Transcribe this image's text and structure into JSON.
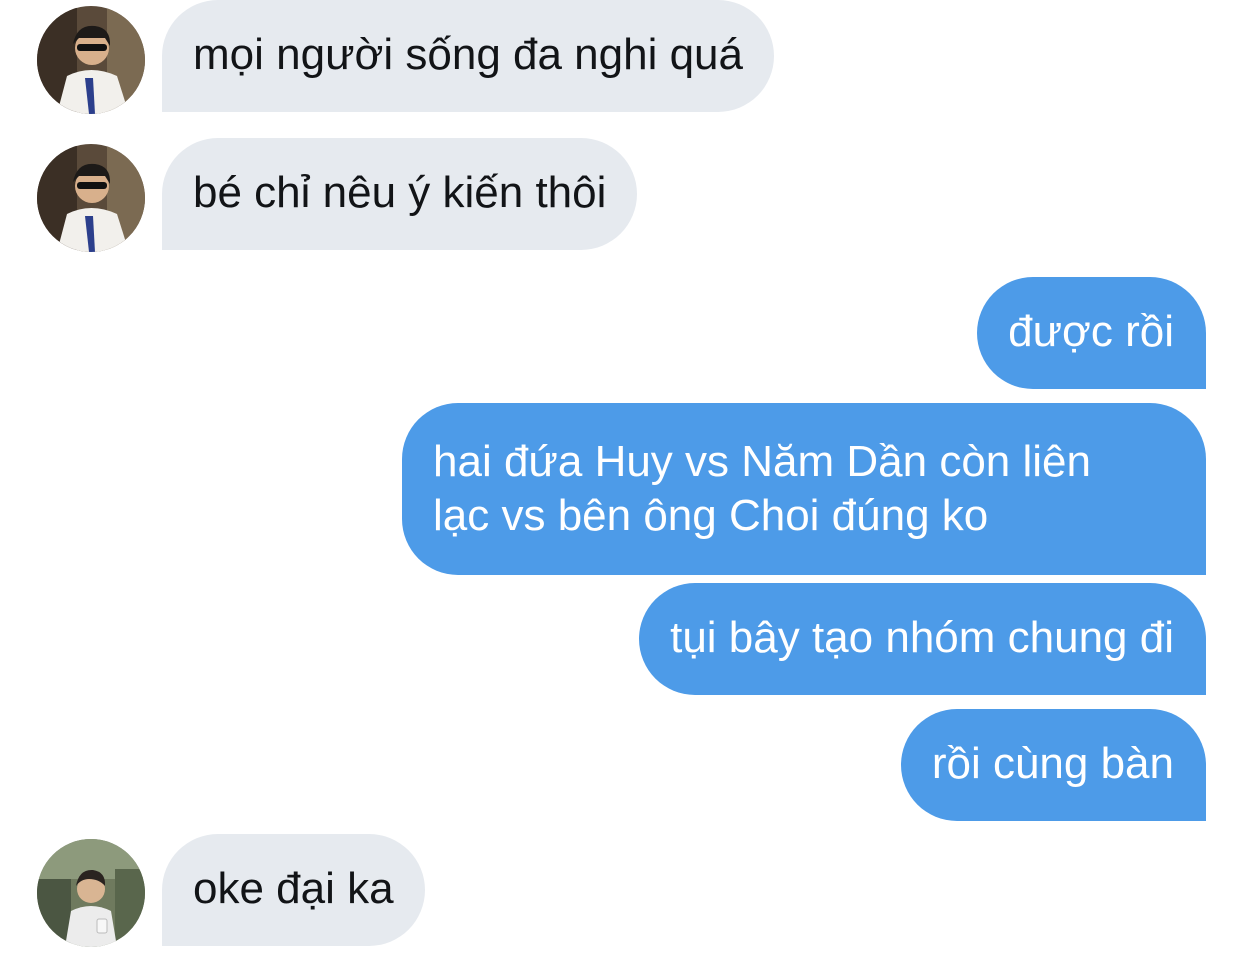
{
  "conversation": {
    "messages": [
      {
        "direction": "incoming",
        "avatar": "avatar-person-sunglasses",
        "text": "mọi người sống đa nghi quá"
      },
      {
        "direction": "incoming",
        "avatar": "avatar-person-sunglasses",
        "text": "bé chỉ nêu ý kiến thôi"
      },
      {
        "direction": "outgoing",
        "text": "được rồi"
      },
      {
        "direction": "outgoing",
        "text_lines": [
          "hai đứa Huy vs Năm Dần còn liên",
          "lạc vs bên ông Choi đúng ko"
        ]
      },
      {
        "direction": "outgoing",
        "text": "tụi bây tạo nhóm chung đi"
      },
      {
        "direction": "outgoing",
        "text": "rồi cùng bàn"
      },
      {
        "direction": "incoming",
        "avatar": "avatar-person-outdoors",
        "text": "oke đại ka"
      }
    ]
  },
  "colors": {
    "incoming_bubble": "#e6eaef",
    "incoming_text": "#121417",
    "outgoing_bubble": "#4d9be8",
    "outgoing_text": "#ffffff",
    "background": "#ffffff"
  }
}
